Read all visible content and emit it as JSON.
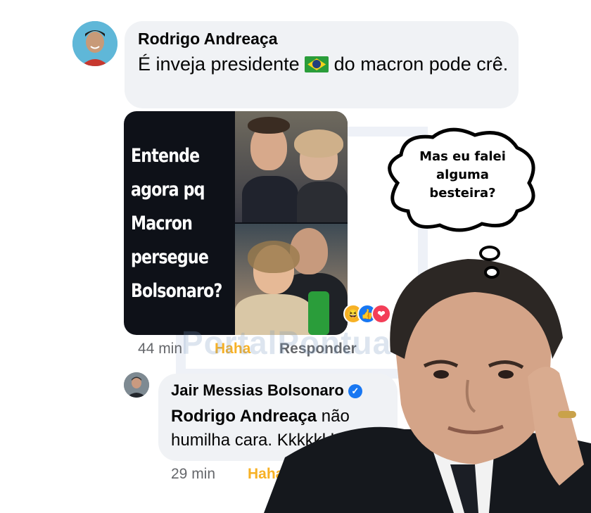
{
  "comment1": {
    "author": "Rodrigo Andreaça",
    "text_before": "É inveja presidente ",
    "text_after": " do macron pode crê.",
    "time": "44 min",
    "reaction_label": "Haha",
    "reply_label": "Responder"
  },
  "meme_image": {
    "caption": "Entende agora pq Macron persegue Bolsonaro?",
    "reactions": [
      "haha-icon",
      "like-icon",
      "love-icon"
    ]
  },
  "comment2": {
    "author": "Jair Messias Bolsonaro",
    "verified": true,
    "mention": "Rodrigo Andreaça",
    "text": " não humilha cara. Kkkkkkk",
    "time": "29 min",
    "reaction_label": "Haha"
  },
  "overlay": {
    "thought_bubble_text": "Mas eu falei alguma besteira?",
    "watermark": "PortalPontual"
  },
  "colors": {
    "bubble_bg": "#f0f2f5",
    "haha": "#f7b125",
    "meta": "#65676b",
    "verified": "#1877f2"
  }
}
